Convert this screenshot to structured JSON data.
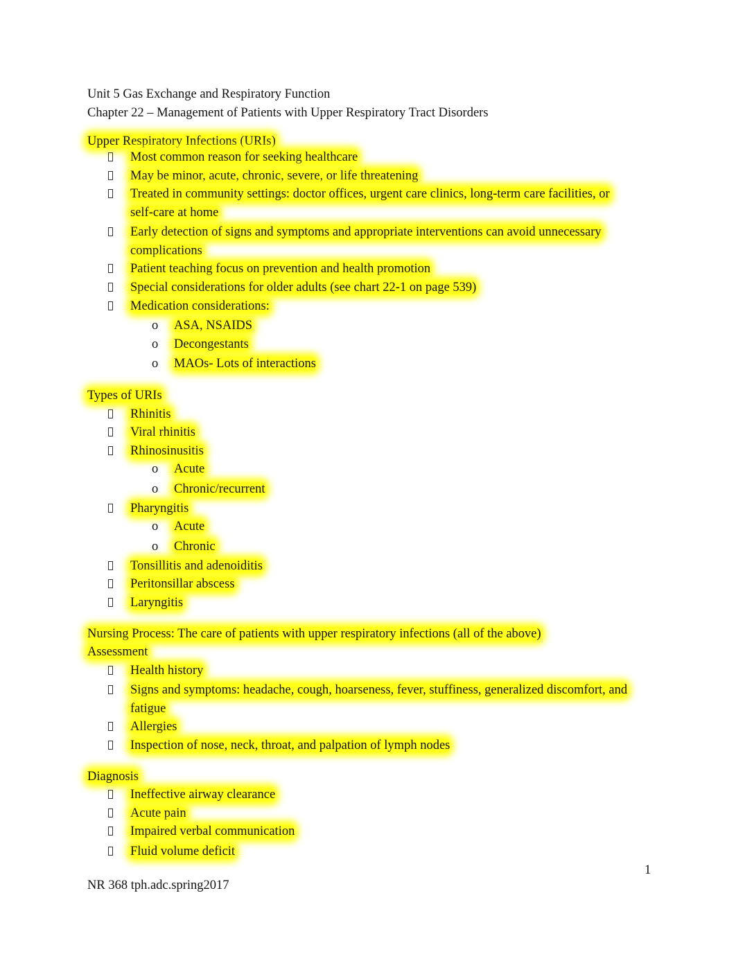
{
  "document": {
    "header": {
      "unit": "Unit 5 Gas Exchange and Respiratory Function",
      "chapter": "Chapter 22 – Management of Patients with Upper Respiratory Tract Disorders"
    },
    "highlight_color": "#ffff00",
    "sections": [
      {
        "heading": "Upper Respiratory Infections (URIs)",
        "items": [
          {
            "text": "Most common reason for seeking healthcare"
          },
          {
            "text": "May be minor, acute, chronic, severe, or life threatening"
          },
          {
            "text": "Treated in community settings: doctor offices, urgent care clinics, long-term care facilities, or",
            "cont": "self-care at home"
          },
          {
            "text": "Early detection of signs and symptoms and appropriate interventions can avoid unnecessary",
            "cont": "complications"
          },
          {
            "text": "Patient teaching focus on prevention and health promotion"
          },
          {
            "text": "Special considerations for older adults (see chart 22-1 on page 539)"
          },
          {
            "text": "Medication considerations:",
            "sub": [
              "ASA, NSAIDS",
              "Decongestants",
              "MAOs- Lots of interactions"
            ]
          }
        ]
      },
      {
        "heading": "Types of URIs",
        "items": [
          {
            "text": "Rhinitis"
          },
          {
            "text": "Viral rhinitis"
          },
          {
            "text": "Rhinosinusitis",
            "sub": [
              "Acute",
              "Chronic/recurrent"
            ]
          },
          {
            "text": "Pharyngitis",
            "sub": [
              "Acute",
              "Chronic"
            ]
          },
          {
            "text": "Tonsillitis and adenoiditis"
          },
          {
            "text": "Peritonsillar abscess"
          },
          {
            "text": "Laryngitis"
          }
        ]
      },
      {
        "heading": "Nursing Process: The care of patients with upper respiratory infections (all of the above)",
        "subheading": "Assessment",
        "items": [
          {
            "text": "Health history"
          },
          {
            "text": "Signs and symptoms: headache, cough, hoarseness, fever, stuffiness, generalized discomfort, and",
            "cont": "fatigue"
          },
          {
            "text": "Allergies"
          },
          {
            "text": "Inspection of nose, neck, throat, and palpation of lymph nodes"
          }
        ]
      },
      {
        "heading": "Diagnosis",
        "items": [
          {
            "text": "Ineffective airway clearance"
          },
          {
            "text": "Acute pain"
          },
          {
            "text": "Impaired verbal communication"
          },
          {
            "text": "Fluid volume deficit"
          }
        ]
      }
    ],
    "footer": {
      "page_number": "1",
      "course": "NR 368 tph.adc.spring2017"
    }
  }
}
